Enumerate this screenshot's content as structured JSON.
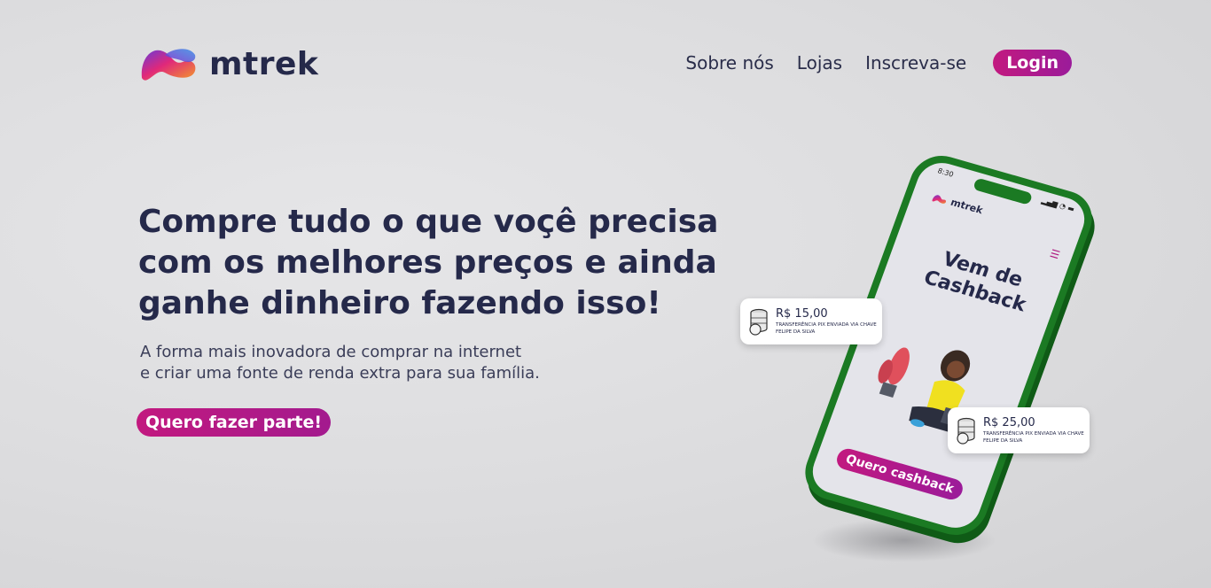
{
  "header": {
    "brand": "mtrek",
    "nav": [
      "Sobre nós",
      "Lojas",
      "Inscreva-se"
    ],
    "login_label": "Login"
  },
  "hero": {
    "headline": "Compre tudo o que voçê precisa com os melhores preços e ainda ganhe dinheiro fazendo isso!",
    "subtext_line1": "A forma mais inovadora de comprar na internet",
    "subtext_line2": "e criar uma fonte de renda extra para sua família.",
    "cta_label": "Quero fazer parte!"
  },
  "phone": {
    "time": "8:30",
    "brand": "mtrek",
    "title": "Vem de Cashback",
    "cta_label": "Quero cashback"
  },
  "notifications": [
    {
      "amount": "R$ 15,00",
      "description": "TRANSFERÊNCIA PIX ENVIADA VIA CHAVE FELIPE DA SILVA"
    },
    {
      "amount": "R$ 25,00",
      "description": "TRANSFERÊNCIA PIX ENVIADA VIA CHAVE FELIPE DA SILVA"
    }
  ],
  "colors": {
    "brand_text": "#25294a",
    "accent": "#c2197f",
    "phone_frame": "#1b7a23"
  }
}
